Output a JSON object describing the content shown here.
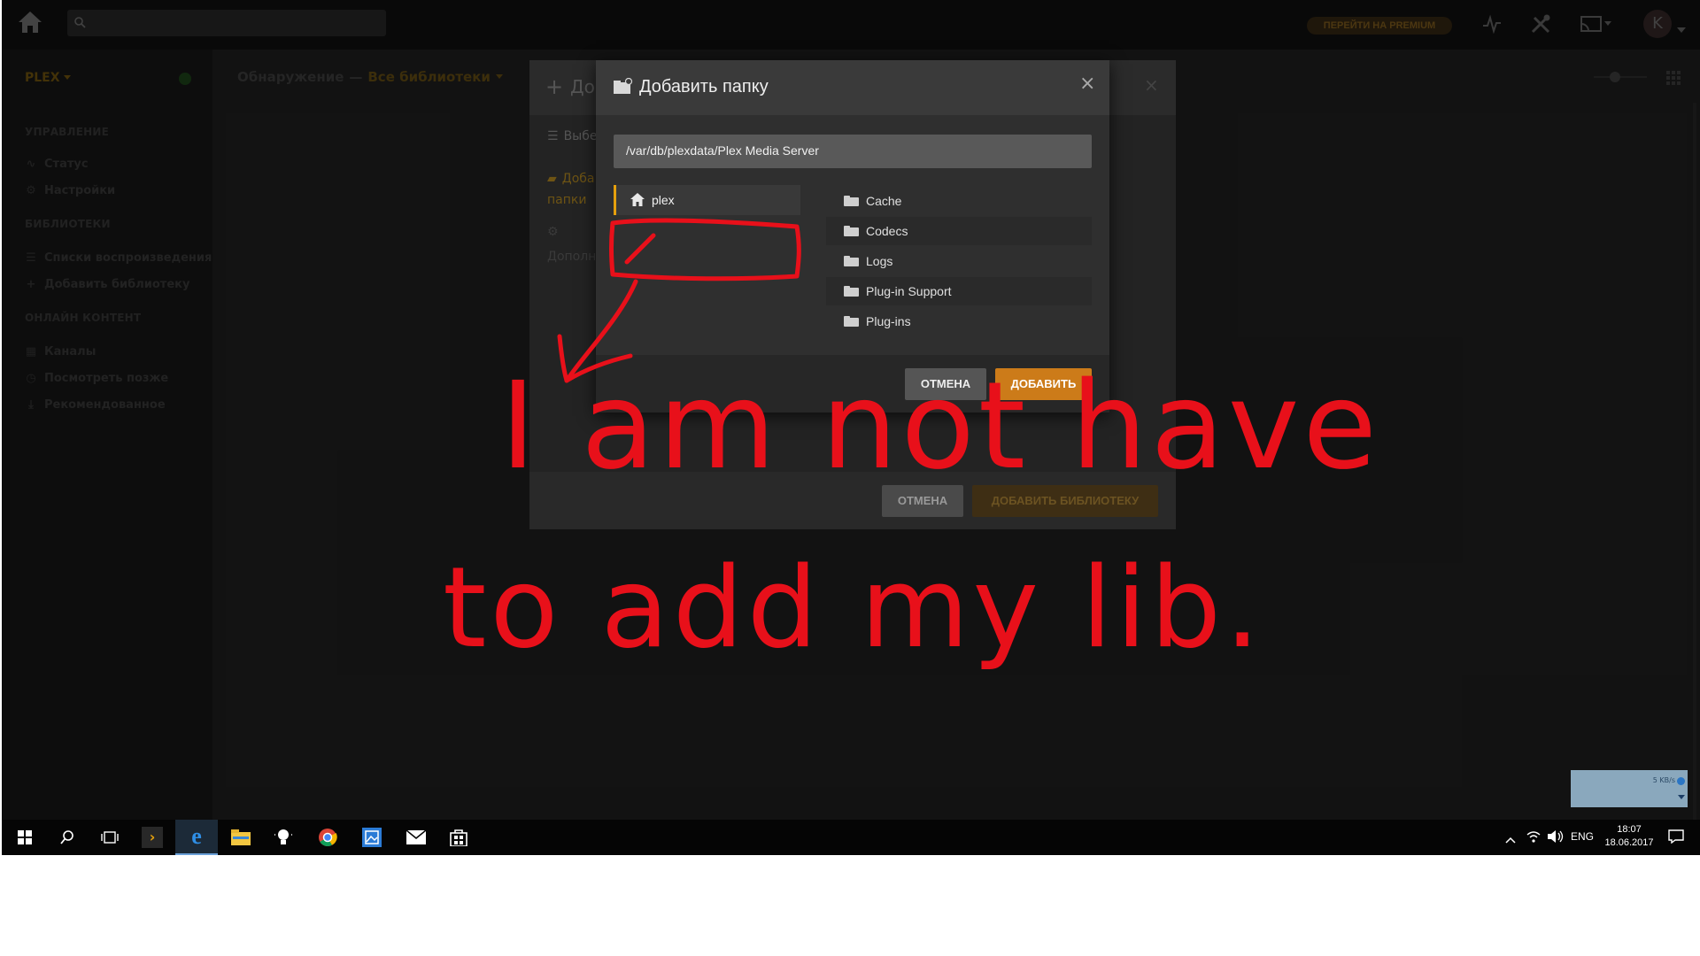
{
  "topbar": {
    "search_placeholder": "",
    "premium_label": "ПЕРЕЙТИ НА PREMIUM",
    "avatar_letter": "K"
  },
  "sidebar": {
    "server_name": "PLEX",
    "section_manage": "УПРАВЛЕНИЕ",
    "item_status": "Статус",
    "item_settings": "Настройки",
    "section_libraries": "БИБЛИОТЕКИ",
    "item_playlists": "Списки воспроизведения",
    "item_add_library": "Добавить библиотеку",
    "section_online": "ОНЛАЙН КОНТЕНТ",
    "item_channels": "Каналы",
    "item_watch_later": "Посмотреть позже",
    "item_recommended": "Рекомендованное"
  },
  "header": {
    "discover": "Обнаружение",
    "separator": "—",
    "all_libraries": "Все библиотеки"
  },
  "background_dialog": {
    "title_partial": "До",
    "step_select": "Выбе",
    "step_add_folders_1": "Доба",
    "step_add_folders_2": "папки",
    "step_advanced": "Дополн",
    "cancel_label": "ОТМЕНА",
    "add_library_label": "ДОБАВИТЬ БИБЛИОТЕКУ"
  },
  "folder_dialog": {
    "title": "Добавить папку",
    "path_value": "/var/db/plexdata/Plex Media Server",
    "home_item": "plex",
    "folders": [
      "Cache",
      "Codecs",
      "Logs",
      "Plug-in Support",
      "Plug-ins"
    ],
    "cancel_label": "ОТМЕНА",
    "add_label": "ДОБАВИТЬ"
  },
  "annotation": {
    "line1": "I am not have",
    "line2": "to add my lib.",
    "color": "#e8101a"
  },
  "net_widget": {
    "speed": "5 KB/s"
  },
  "taskbar": {
    "language": "ENG",
    "time": "18:07",
    "date": "18.06.2017"
  },
  "colors": {
    "accent": "#e5a00d",
    "add_button": "#cc7b19",
    "cancel_button": "#555555"
  }
}
